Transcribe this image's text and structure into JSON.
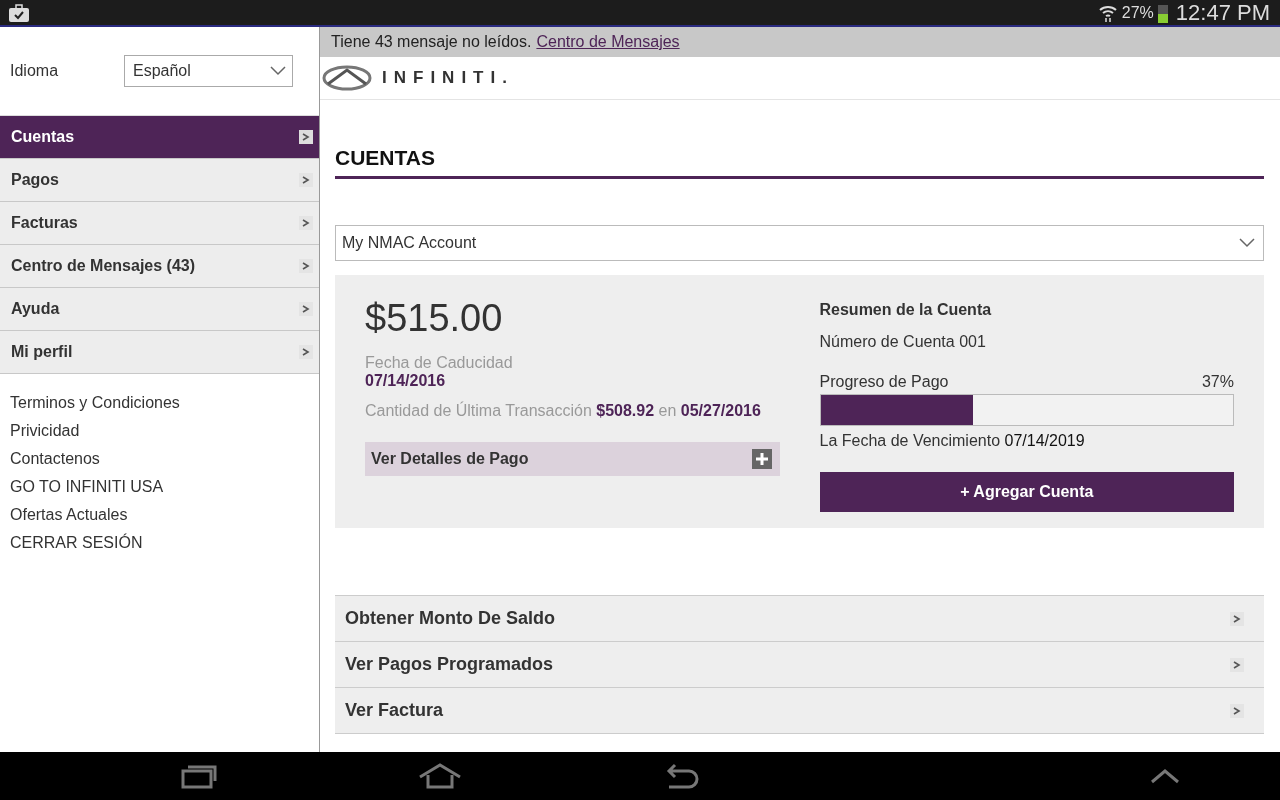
{
  "status_bar": {
    "battery_text": "27%",
    "time": "12:47 PM"
  },
  "language": {
    "label": "Idioma",
    "value": "Español"
  },
  "sidebar": {
    "items": [
      {
        "label": "Cuentas",
        "selected": true
      },
      {
        "label": "Pagos",
        "selected": false
      },
      {
        "label": "Facturas",
        "selected": false
      },
      {
        "label": "Centro de Mensajes (43)",
        "selected": false
      },
      {
        "label": "Ayuda",
        "selected": false
      },
      {
        "label": "Mi perfil",
        "selected": false
      }
    ],
    "links": [
      "Terminos y Condiciones",
      "Privicidad",
      "Contactenos",
      "GO TO INFINITI USA",
      "Ofertas Actuales",
      "CERRAR SESIÓN"
    ]
  },
  "notice": {
    "text": "Tiene 43 mensaje no leídos.",
    "link": "Centro de Mensajes"
  },
  "logo": {
    "text": "INFINITI."
  },
  "page_title": "CUENTAS",
  "account_select": {
    "value": "My NMAC Account"
  },
  "summary": {
    "amount": "$515.00",
    "due_label": "Fecha de Caducidad",
    "due_date": "07/14/2016",
    "last_transaction": "Cantidad de Última Transacción **$508.92** en **05/27/2016**",
    "details_button": "Ver Detalles de Pago",
    "title": "Resumen de la Cuenta",
    "account_number": "Número de Cuenta 001",
    "progress_label": "Progreso de Pago",
    "progress_text": "37%",
    "level": 0.37,
    "maturity_label": "La Fecha de Vencimiento",
    "maturity_date": "07/14/2019",
    "add_button": "+ Agregar Cuenta"
  },
  "actions": [
    "Obtener Monto De Saldo",
    "Ver Pagos Programados",
    "Ver Factura"
  ]
}
